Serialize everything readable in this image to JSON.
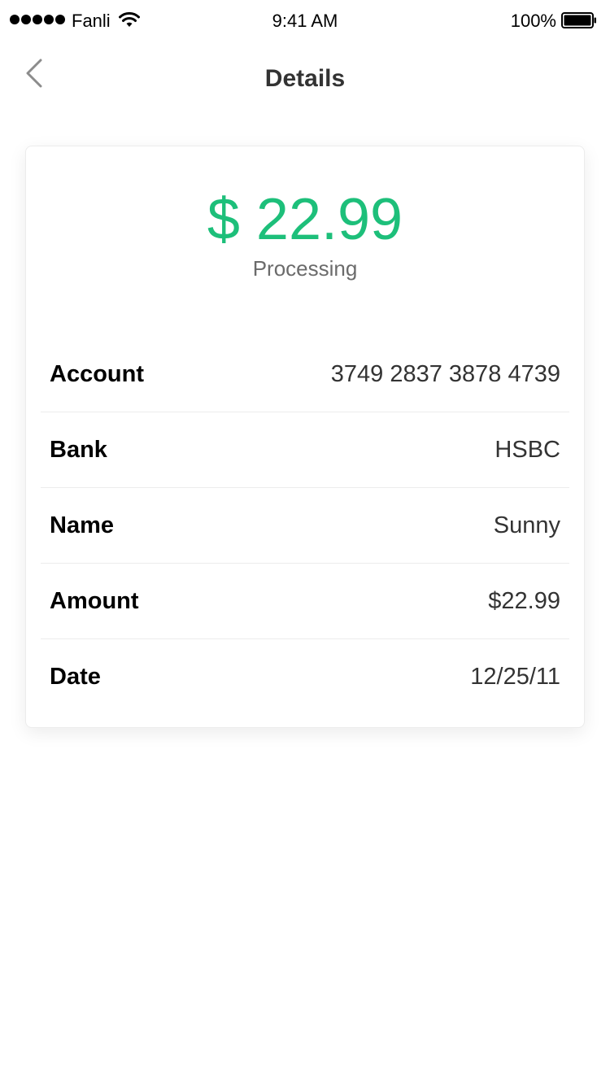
{
  "status_bar": {
    "carrier": "Fanli",
    "time": "9:41 AM",
    "battery_percent": "100%"
  },
  "nav": {
    "back_icon": "chevron-left-icon",
    "title": "Details"
  },
  "summary": {
    "amount": "$ 22.99",
    "status": "Processing",
    "accent_color": "#1dbf7a"
  },
  "details": [
    {
      "label": "Account",
      "value": "3749 2837 3878 4739"
    },
    {
      "label": "Bank",
      "value": "HSBC"
    },
    {
      "label": "Name",
      "value": "Sunny"
    },
    {
      "label": "Amount",
      "value": "$22.99"
    },
    {
      "label": "Date",
      "value": "12/25/11"
    }
  ]
}
